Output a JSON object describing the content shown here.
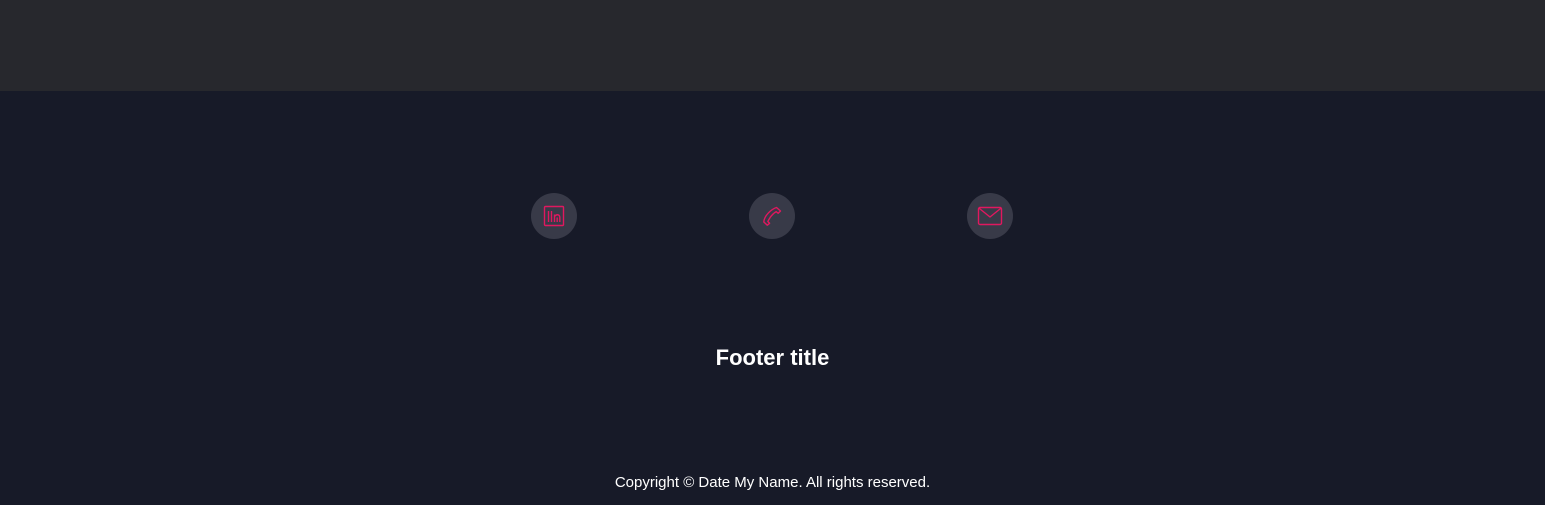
{
  "footer": {
    "title": "Footer title",
    "copyright": "Copyright © Date My Name. All rights reserved.",
    "social_links": [
      {
        "icon": "linkedin-icon"
      },
      {
        "icon": "phone-icon"
      },
      {
        "icon": "email-icon"
      }
    ]
  },
  "colors": {
    "top_bar": "#27282d",
    "footer_bg": "#171a28",
    "icon_circle": "#383a48",
    "accent": "#e0185f",
    "text": "#ffffff"
  }
}
